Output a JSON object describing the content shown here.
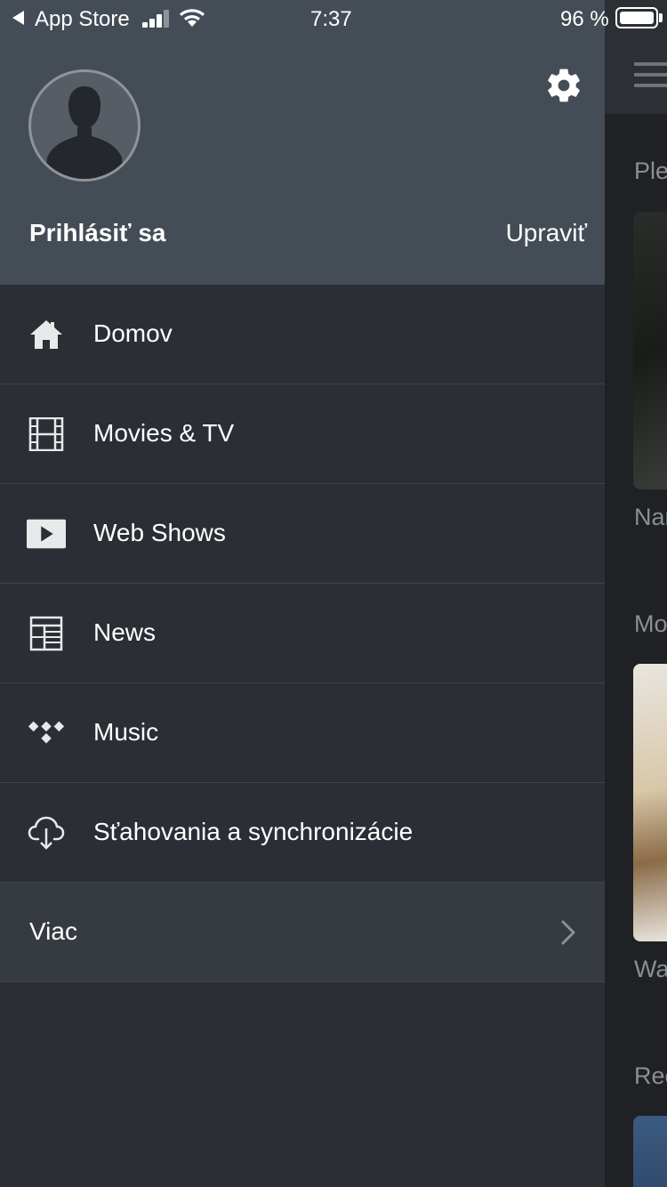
{
  "status_bar": {
    "back_app": "App Store",
    "time": "7:37",
    "battery": "96 %"
  },
  "profile": {
    "login_label": "Prihlásiť sa",
    "edit_label": "Upraviť"
  },
  "menu": {
    "items": [
      {
        "label": "Domov",
        "icon": "home-icon"
      },
      {
        "label": "Movies & TV",
        "icon": "film-icon"
      },
      {
        "label": "Web Shows",
        "icon": "play-icon"
      },
      {
        "label": "News",
        "icon": "news-icon"
      },
      {
        "label": "Music",
        "icon": "music-icon"
      },
      {
        "label": "Sťahovania a synchronizácie",
        "icon": "cloud-download-icon"
      }
    ],
    "more_label": "Viac"
  },
  "background": {
    "section_1": "Ple",
    "item_1": "Nar",
    "section_2": "Mo",
    "item_2": "Wa",
    "section_3": "Rec"
  },
  "colors": {
    "drawer_header": "#444c55",
    "drawer_body": "#2b2e34",
    "more_row": "#363a41",
    "divider": "#3f434a"
  }
}
